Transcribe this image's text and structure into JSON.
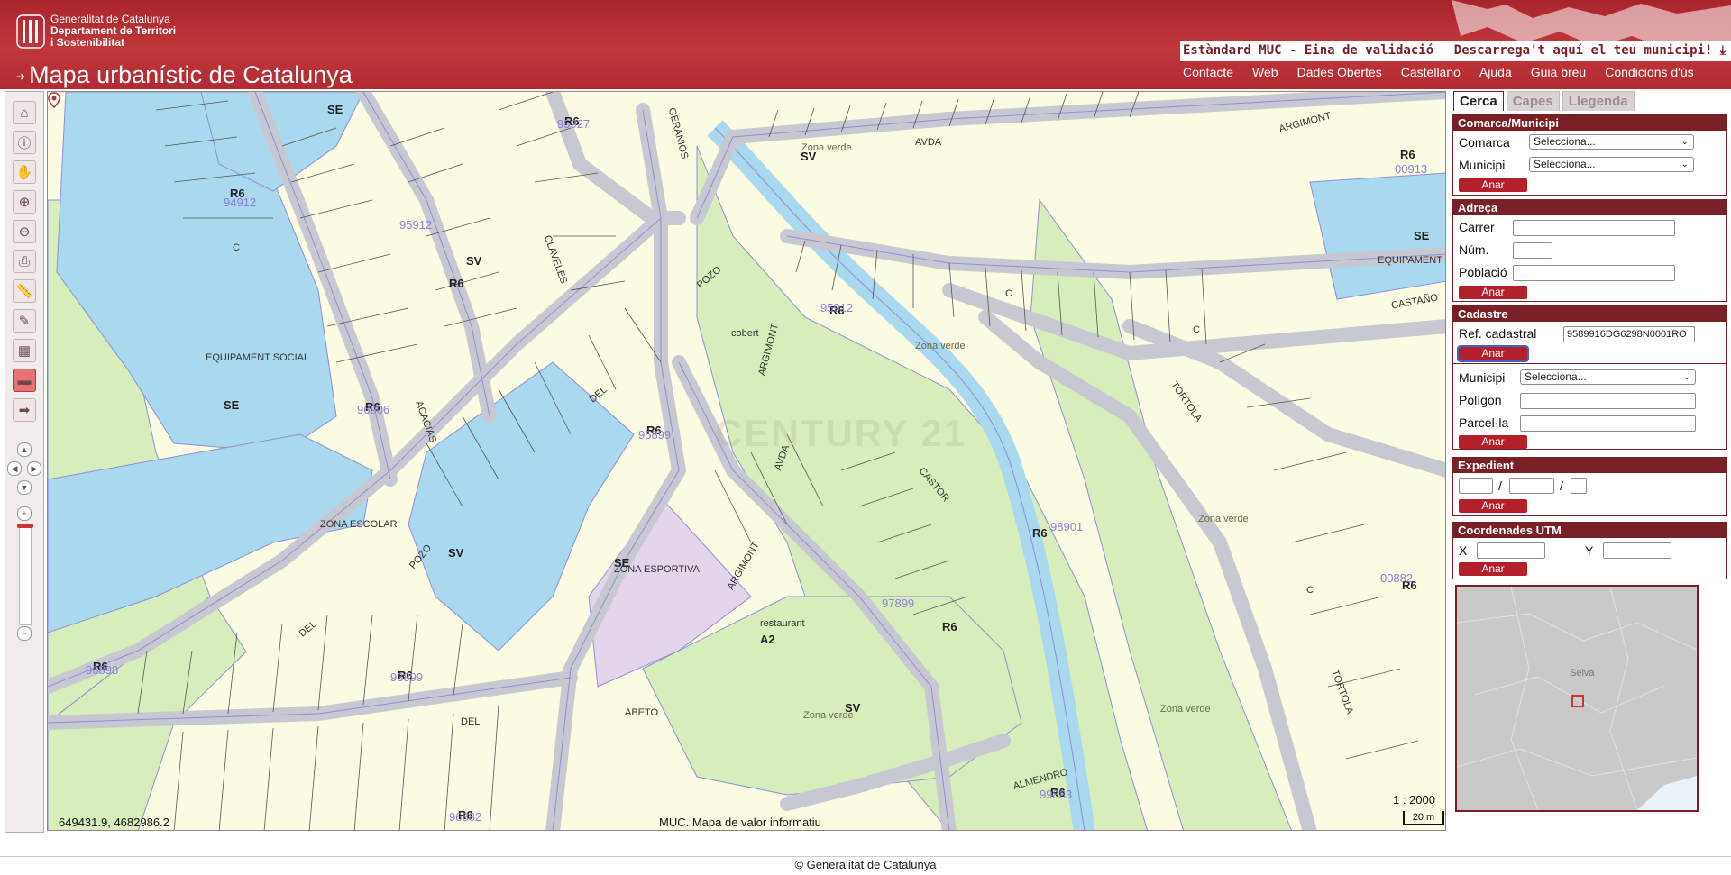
{
  "header": {
    "gencat_line1": "Generalitat de Catalunya",
    "gencat_line2": "Departament de Territori",
    "gencat_line3": "i Sostenibilitat",
    "app_title": "Mapa urbanístic de Catalunya",
    "promo_left": "Estàndard MUC - Eina de validació",
    "promo_right": "Descarrega't aquí el teu municipi! ⤓",
    "nav": [
      "Contacte",
      "Web",
      "Dades Obertes",
      "Castellano",
      "Ajuda",
      "Guia breu",
      "Condicions d'ús"
    ]
  },
  "toolbar": {
    "tools": [
      "home-icon",
      "info-icon",
      "pan-hand-icon",
      "zoom-in-icon",
      "zoom-out-icon",
      "print-icon",
      "measure-icon",
      "erase-icon",
      "layer-icon",
      "active-tool-icon",
      "next-icon"
    ]
  },
  "map": {
    "coords": "649431.9, 4682986.2",
    "note": "MUC. Mapa de valor informatiu",
    "scale_ratio": "1 : 2000",
    "scale_bar": "20 m",
    "watermark": "CENTURY 21",
    "labels": {
      "se1": "SE",
      "se2": "SE",
      "se3": "SE",
      "se4": "SE",
      "equip_social": "EQUIPAMENT SOCIAL",
      "zona_escolar": "ZONA ESCOLAR",
      "zona_esportiva": "ZONA ESPORTIVA",
      "equipament": "EQUIPAMENT",
      "restaurant": "restaurant",
      "a2": "A2",
      "cobert": "cobert",
      "zona_verde": "Zona verde",
      "sv": "SV",
      "r6": "R6",
      "argimont": "ARGIMONT",
      "avda": "AVDA",
      "pozo": "POZO",
      "del": "DEL",
      "acacias": "ACACIAS",
      "claveles": "CLAVELES",
      "geranios": "GERANIOS",
      "castor": "CASTOR",
      "tortola": "TORTOLA",
      "castano": "CASTAÑO",
      "almendro": "ALMENDRO",
      "abeto": "ABETO",
      "c": "C",
      "b95912": "95912",
      "b94912": "94912",
      "b97899": "97899",
      "b95899": "95899",
      "b98901": "98901",
      "b00913": "00913",
      "b96898": "96898",
      "b93899": "93899",
      "b96882": "96882",
      "b00882": "00882",
      "b99883": "99883",
      "b95927": "95927",
      "b96906": "96906"
    }
  },
  "panel": {
    "tabs": [
      "Cerca",
      "Capes",
      "Llegenda"
    ],
    "comarca": {
      "title": "Comarca/Municipi",
      "comarca_label": "Comarca",
      "comarca_value": "Selecciona...",
      "municipi_label": "Municipi",
      "municipi_value": "Selecciona...",
      "button": "Anar"
    },
    "adreca": {
      "title": "Adreça",
      "carrer": "Carrer",
      "num": "Núm.",
      "poblacio": "Població",
      "button": "Anar"
    },
    "cadastre": {
      "title": "Cadastre",
      "ref_label": "Ref. cadastral",
      "ref_value": "9589916DG6298N0001RO",
      "button": "Anar",
      "municipi_label": "Municipi",
      "municipi_value": "Selecciona...",
      "poligon": "Polígon",
      "parcela": "Parcel·la",
      "button2": "Anar"
    },
    "expedient": {
      "title": "Expedient",
      "sep1": "/",
      "sep2": "/",
      "button": "Anar"
    },
    "utm": {
      "title": "Coordenades UTM",
      "x": "X",
      "y": "Y",
      "button": "Anar"
    },
    "overview": {
      "label": "Selva"
    }
  },
  "footer": {
    "text": "© Generalitat de Catalunya"
  }
}
